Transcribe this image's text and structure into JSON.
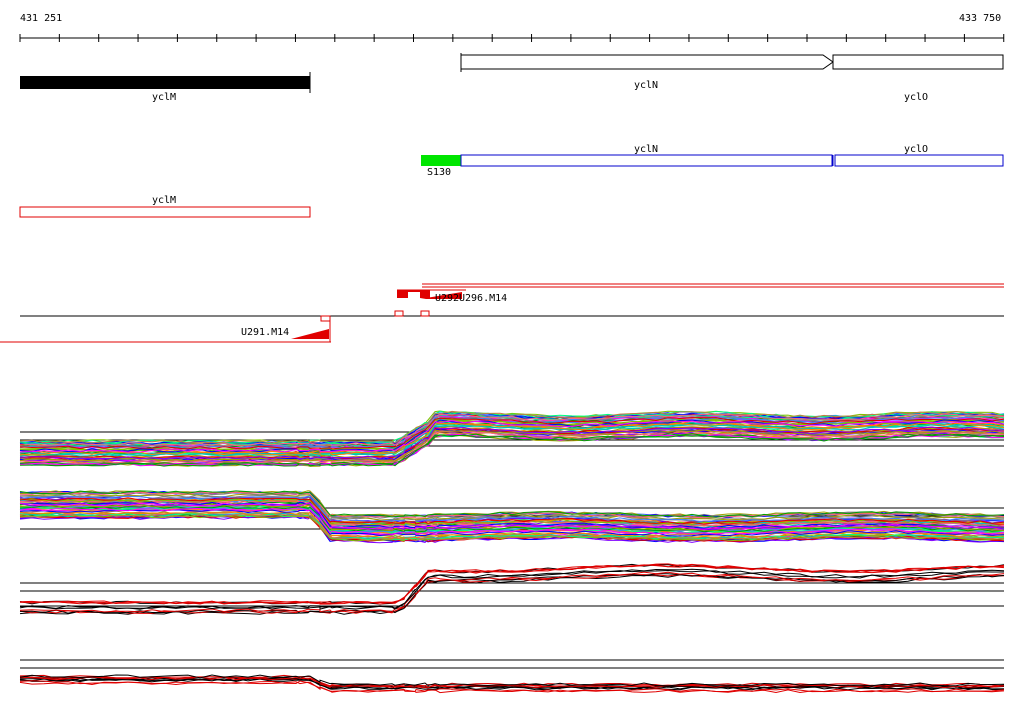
{
  "ruler": {
    "start_label": "431 251",
    "end_label": "433 750"
  },
  "genes": [
    {
      "name": "yclM",
      "fill": "#000000",
      "strand": "none"
    },
    {
      "name": "yclN",
      "fill": "#ffffff",
      "strand": "+"
    },
    {
      "name": "yclO",
      "fill": "#ffffff",
      "strand": "+"
    }
  ],
  "operon_track": [
    {
      "name": "S130",
      "color": "#00e600"
    },
    {
      "name": "yclN",
      "color": "#0000cc"
    },
    {
      "name": "yclO",
      "color": "#0000cc"
    }
  ],
  "red_track": [
    {
      "name": "yclM",
      "color": "#e00000"
    }
  ],
  "features": [
    {
      "name": "U291.M14"
    },
    {
      "name": "U292"
    },
    {
      "name": "U296.M14"
    }
  ],
  "colors": {
    "red": "#e00000",
    "blue": "#0000cc",
    "green": "#00e600",
    "profile_palette": [
      "#e00000",
      "#00a000",
      "#0000ff",
      "#ff00ff",
      "#00c0c0",
      "#a0a000",
      "#ff8000",
      "#8000ff",
      "#808080",
      "#00ff80",
      "#c08040",
      "#ff6080",
      "#4080ff",
      "#80c000"
    ]
  }
}
